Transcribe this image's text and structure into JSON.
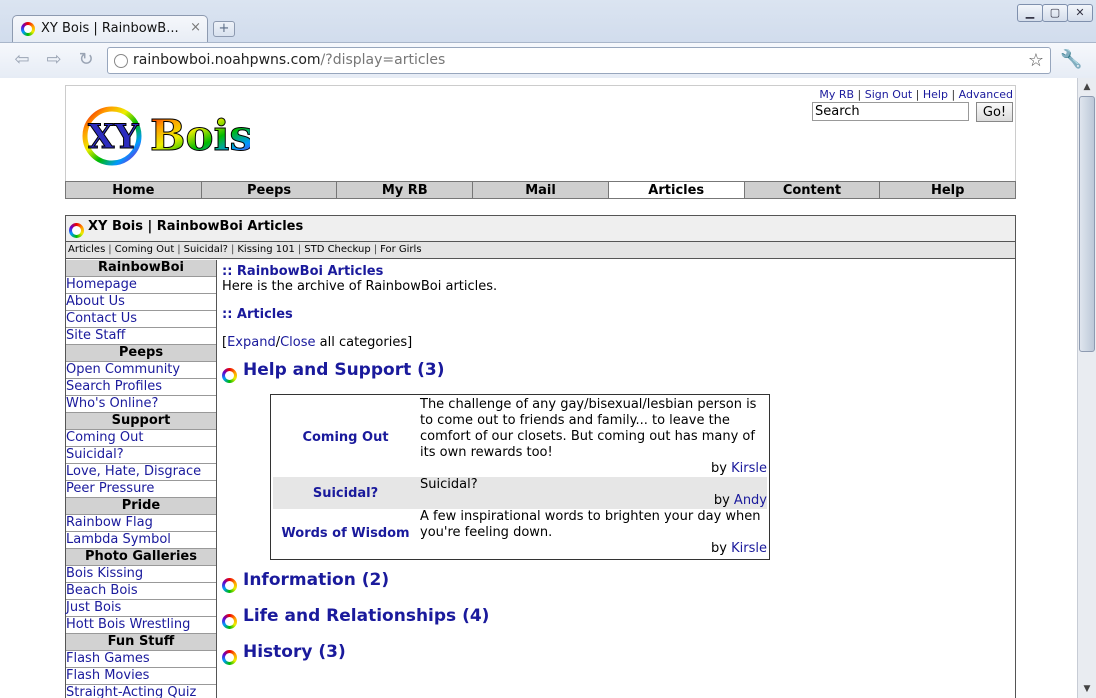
{
  "browser": {
    "tab_title": "XY Bois | RainbowB...",
    "tab_close": "×",
    "new_tab": "+",
    "url_host": "rainbowboi.noahpwns.com",
    "url_path": "/?display=articles"
  },
  "header": {
    "logo_text": "XY Bois",
    "toplinks": [
      "My RB",
      "Sign Out",
      "Help",
      "Advanced"
    ],
    "search_placeholder": "Search",
    "go_label": "Go!"
  },
  "mainnav": [
    "Home",
    "Peeps",
    "My RB",
    "Mail",
    "Articles",
    "Content",
    "Help"
  ],
  "mainnav_active": "Articles",
  "panel": {
    "title": "XY Bois | RainbowBoi Articles",
    "subnav": [
      "Articles",
      "Coming Out",
      "Suicidal?",
      "Kissing 101",
      "STD Checkup",
      "For Girls"
    ]
  },
  "sidebar": [
    {
      "heading": "RainbowBoi",
      "items": [
        "Homepage",
        "About Us",
        "Contact Us",
        "Site Staff"
      ]
    },
    {
      "heading": "Peeps",
      "items": [
        "Open Community",
        "Search Profiles",
        "Who's Online?"
      ]
    },
    {
      "heading": "Support",
      "items": [
        "Coming Out",
        "Suicidal?",
        "Love, Hate, Disgrace",
        "Peer Pressure"
      ]
    },
    {
      "heading": "Pride",
      "items": [
        "Rainbow Flag",
        "Lambda Symbol"
      ]
    },
    {
      "heading": "Photo Galleries",
      "items": [
        "Bois Kissing",
        "Beach Bois",
        "Just Bois",
        "Hott Bois Wrestling"
      ]
    },
    {
      "heading": "Fun Stuff",
      "items": [
        "Flash Games",
        "Flash Movies",
        "Straight-Acting Quiz"
      ]
    }
  ],
  "main": {
    "archive_heading": ":: RainbowBoi Articles",
    "archive_text": "Here is the archive of RainbowBoi articles.",
    "articles_heading": ":: Articles",
    "expand_prefix": "[",
    "expand_label": "Expand",
    "slash": "/",
    "close_label": "Close",
    "expand_suffix": " all categories]",
    "by_label": "by",
    "categories": [
      {
        "title": "Help and Support (3)"
      },
      {
        "title": "Information (2)"
      },
      {
        "title": "Life and Relationships (4)"
      },
      {
        "title": "History (3)"
      }
    ],
    "articles": [
      {
        "title": "Coming Out",
        "desc": "The challenge of any gay/bisexual/lesbian person is to come out to friends and family... to leave the comfort of our closets. But coming out has many of its own rewards too!",
        "author": "Kirsle"
      },
      {
        "title": "Suicidal?",
        "desc": "Suicidal?",
        "author": "Andy"
      },
      {
        "title": "Words of Wisdom",
        "desc": "A few inspirational words to brighten your day when you're feeling down.",
        "author": "Kirsle"
      }
    ]
  }
}
